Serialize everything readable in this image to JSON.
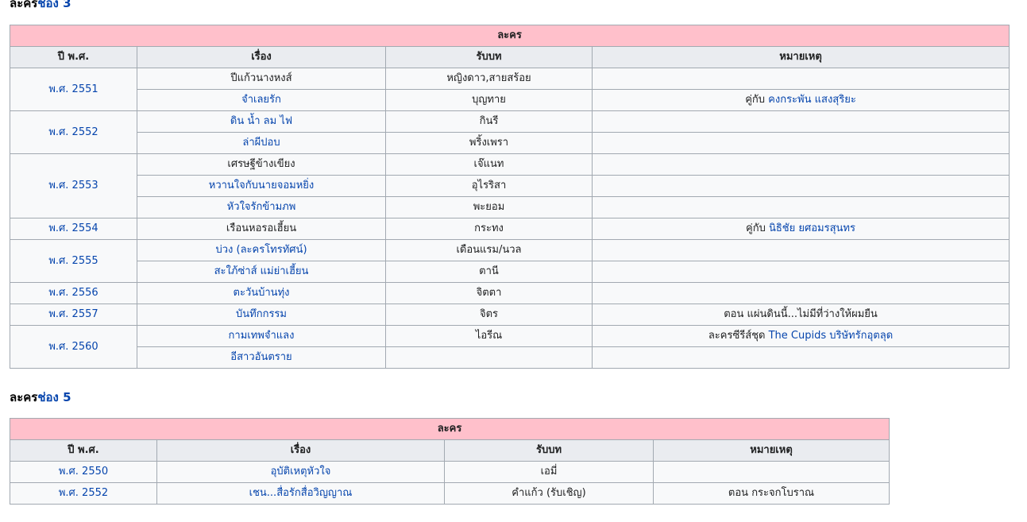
{
  "section1": {
    "heading_plain": "ละคร",
    "heading_link": "ช่อง 3",
    "group_header": "ละคร",
    "columns": [
      "ปี พ.ศ.",
      "เรื่อง",
      "รับบท",
      "หมายเหตุ"
    ],
    "years": [
      "พ.ศ. 2551",
      "พ.ศ. 2552",
      "พ.ศ. 2553",
      "พ.ศ. 2554",
      "พ.ศ. 2555",
      "พ.ศ. 2556",
      "พ.ศ. 2557",
      "พ.ศ. 2560"
    ],
    "rows": [
      {
        "title": "ปีแก้วนางหงส์",
        "role": "หญิงดาว,สายสร้อย",
        "note_prefix": "",
        "note_link": ""
      },
      {
        "title": "จำเลยรัก",
        "role": "บุญทาย",
        "note_prefix": "คู่กับ ",
        "note_link": "คงกระพัน แสงสุริยะ"
      },
      {
        "title": "ดิน น้ำ ลม ไฟ",
        "role": "กินรี",
        "note_prefix": "",
        "note_link": ""
      },
      {
        "title": "ล่าผีปอบ",
        "role": "พริ้งเพรา",
        "note_prefix": "",
        "note_link": ""
      },
      {
        "title": "เศรษฐีข้างเขียง",
        "role": "เจ๊แนท",
        "note_prefix": "",
        "note_link": ""
      },
      {
        "title": "หวานใจกับนายจอมหยิ่ง",
        "role": "อุไรริสา",
        "note_prefix": "",
        "note_link": ""
      },
      {
        "title": "หัวใจรักข้ามภพ",
        "role": "พะยอม",
        "note_prefix": "",
        "note_link": ""
      },
      {
        "title": "เรือนหอรอเฮี้ยน",
        "role": "กระทง",
        "note_prefix": "คู่กับ ",
        "note_link": "นิธิชัย ยศอมรสุนทร"
      },
      {
        "title": "บ่วง (ละครโทรทัศน์)",
        "role": "เดือนแรม/นวล",
        "note_prefix": "",
        "note_link": ""
      },
      {
        "title": "สะใภ้ซ่าส์ แม่ย่าเฮี้ยน",
        "role": "ตานี",
        "note_prefix": "",
        "note_link": ""
      },
      {
        "title": "ตะวันบ้านทุ่ง",
        "role": "จิตตา",
        "note_prefix": "",
        "note_link": ""
      },
      {
        "title": "บันทึกกรรม",
        "role": "จิตร",
        "note_prefix": "ตอน แผ่นดินนี้...ไม่มีที่ว่างให้ผมยืน",
        "note_link": ""
      },
      {
        "title": "กามเทพจำแลง",
        "role": "ไอรีณ",
        "note_prefix": "ละครซีรีส์ชุด ",
        "note_link": "The Cupids บริษัทรักอุตลุด"
      },
      {
        "title": "อีสาวอันตราย",
        "role": "",
        "note_prefix": "",
        "note_link": ""
      }
    ]
  },
  "section2": {
    "heading_plain": "ละคร",
    "heading_link": "ช่อง 5",
    "group_header": "ละคร",
    "columns": [
      "ปี พ.ศ.",
      "เรื่อง",
      "รับบท",
      "หมายเหตุ"
    ],
    "years": [
      "พ.ศ. 2550",
      "พ.ศ. 2552"
    ],
    "rows": [
      {
        "title": "อุบัติเหตุหัวใจ",
        "role": "เอมี่",
        "note": ""
      },
      {
        "title": "เชน...สื่อรักสื่อวิญญาณ",
        "role": "คำแก้ว (รับเชิญ)",
        "note": "ตอน กระจกโบราณ"
      }
    ]
  }
}
